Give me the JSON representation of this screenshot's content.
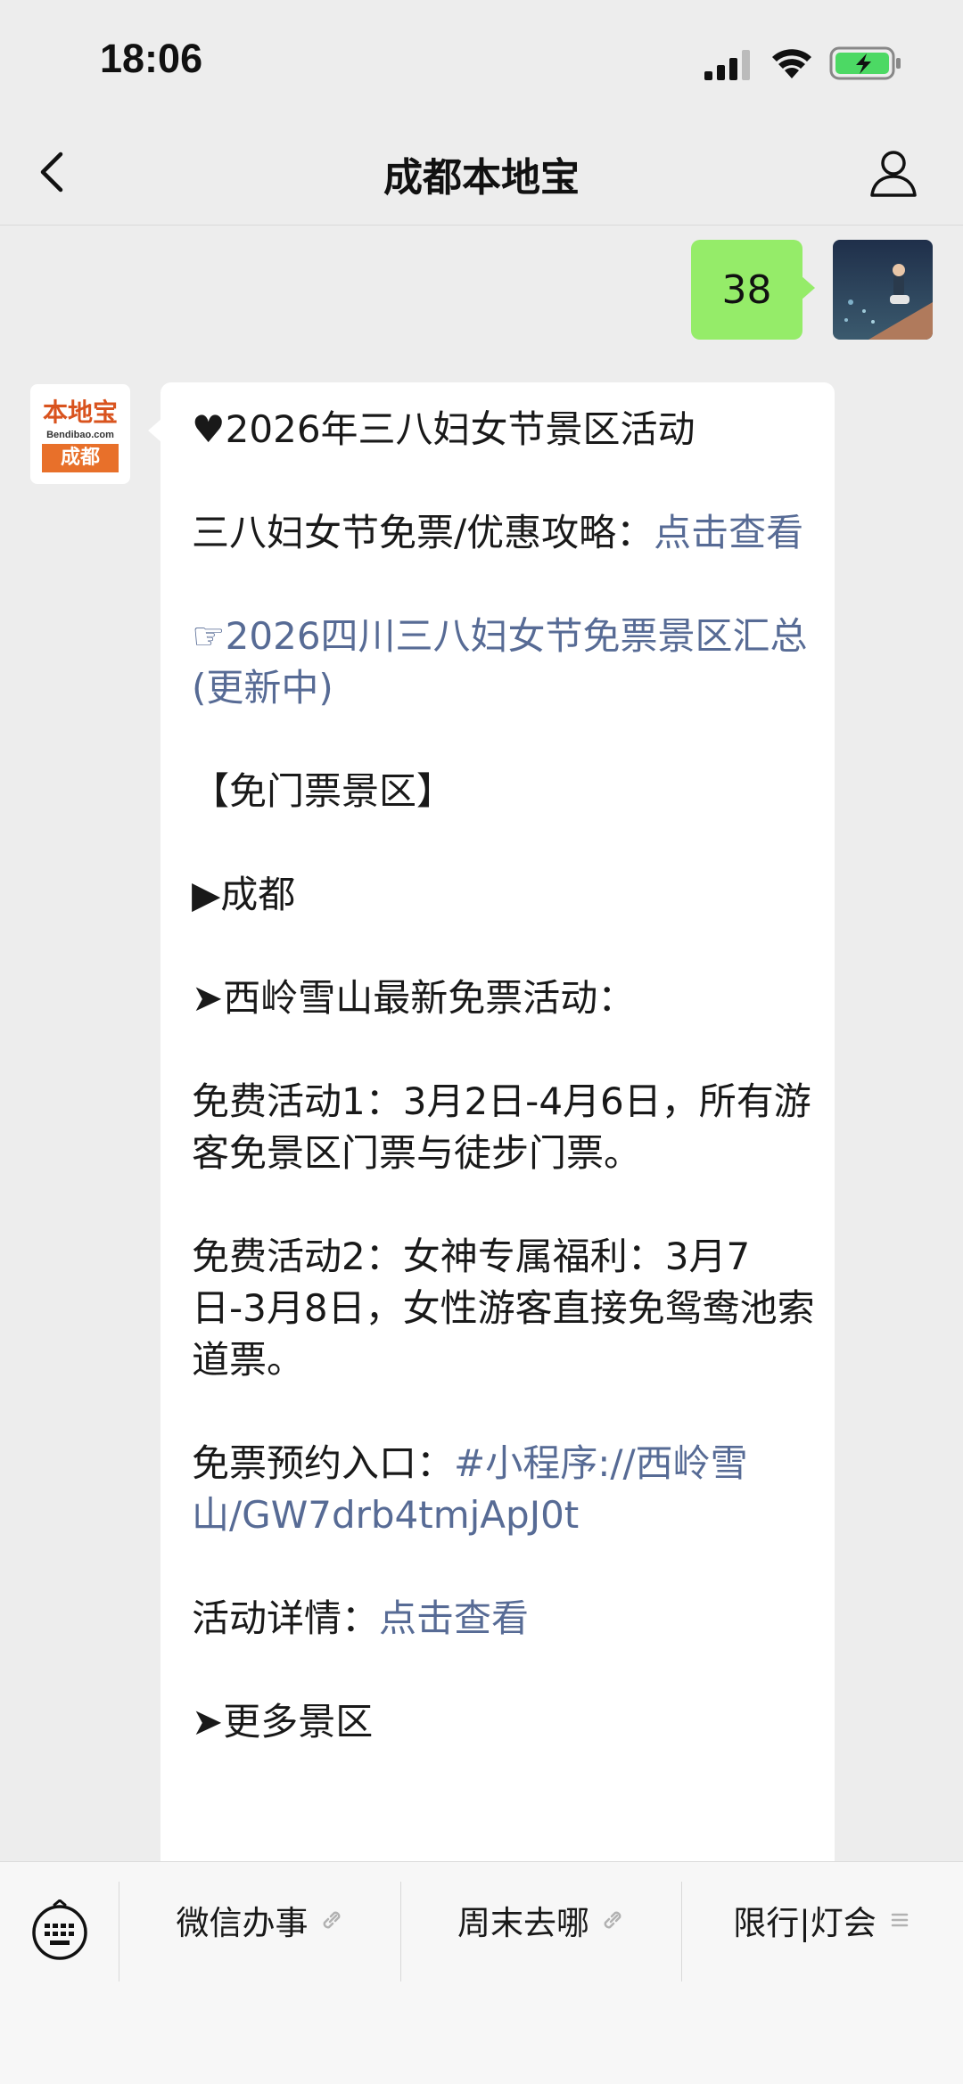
{
  "status_bar": {
    "time": "18:06"
  },
  "nav": {
    "title": "成都本地宝"
  },
  "chat": {
    "my_message": "38",
    "bot_logo": {
      "top": "本地宝",
      "mid": "Bendibao.com",
      "bottom": "成都"
    },
    "reply": {
      "line1": "♥2026年三八妇女节景区活动",
      "line2_text": "三八妇女节免票/优惠攻略：",
      "line2_link": "点击查看",
      "line3_link": "☞2026四川三八妇女节免票景区汇总(更新中)",
      "line4": "【免门票景区】",
      "line5": "▶成都",
      "line6": "➤西岭雪山最新免票活动：",
      "line7": "免费活动1：3月2日-4月6日，所有游客免景区门票与徒步门票。",
      "line8": "免费活动2：女神专属福利：3月7日-3月8日，女性游客直接免鸳鸯池索道票。",
      "line9_text": "免票预约入口：",
      "line9_link": "#小程序://西岭雪山/GW7drb4tmjApJ0t",
      "line10_text": "活动详情：",
      "line10_link": "点击查看",
      "line11": "➤更多景区"
    }
  },
  "bottom_menu": {
    "items": [
      "微信办事",
      "周末去哪",
      "限行|灯会"
    ]
  },
  "colors": {
    "link": "#576b95",
    "my_bubble": "#95ec69",
    "background": "#ededed"
  }
}
